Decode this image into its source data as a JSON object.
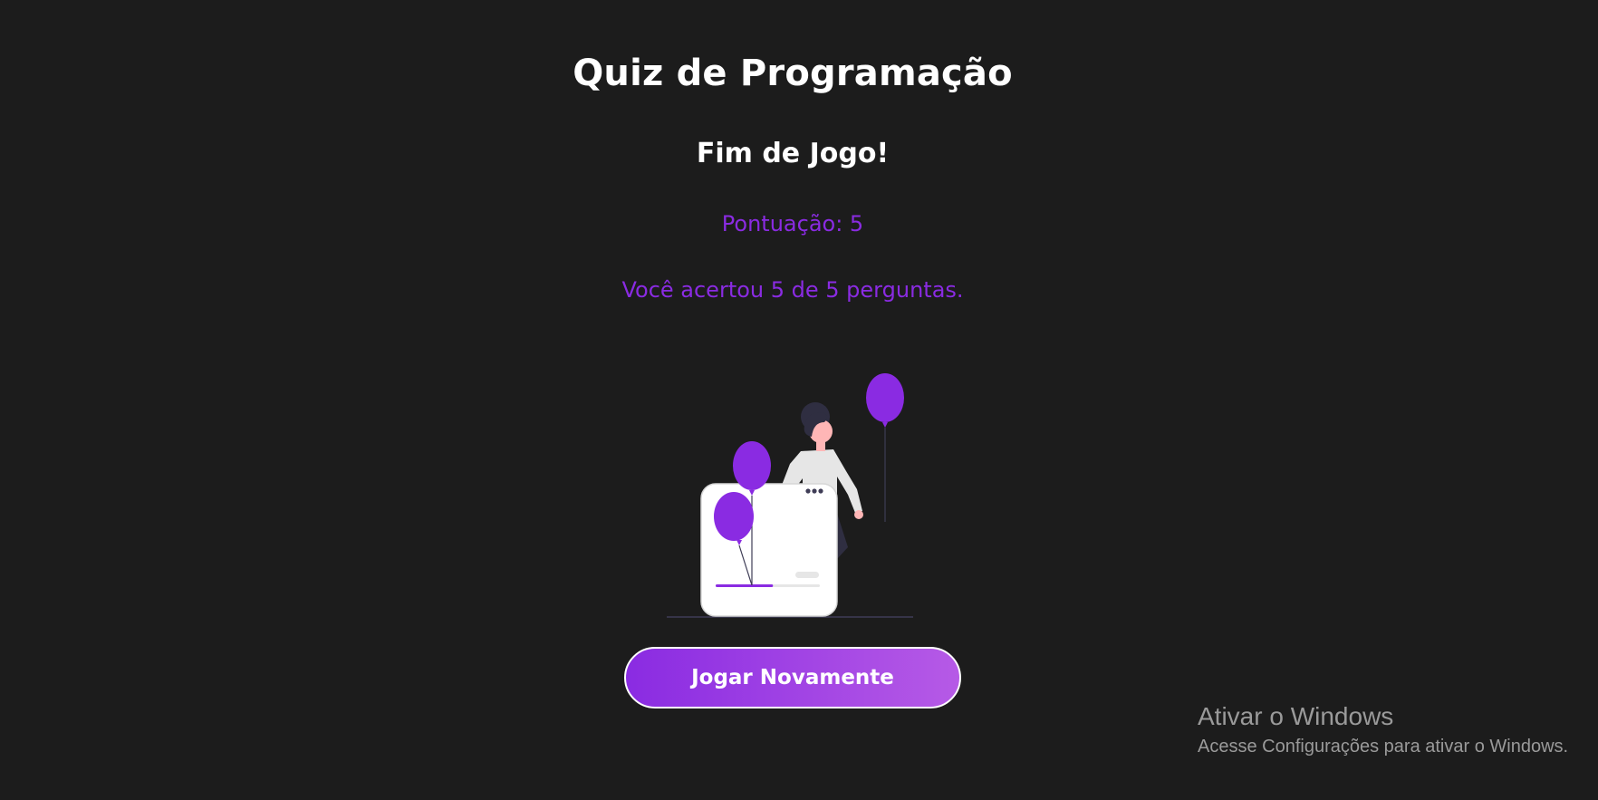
{
  "app": {
    "title": "Quiz de Programação"
  },
  "result": {
    "heading": "Fim de Jogo!",
    "score_text": "Pontuação: 5",
    "summary_text": "Você acertou 5 de 5 perguntas."
  },
  "actions": {
    "play_again_label": "Jogar Novamente"
  },
  "illustration": {
    "icon": "celebration-balloons-illustration",
    "progress": 0.55
  },
  "os_watermark": {
    "title": "Ativar o Windows",
    "subtitle": "Acesse Configurações para ativar o Windows."
  },
  "colors": {
    "background": "#1c1c1c",
    "accent": "#8a2be2",
    "accent_light": "#b65ae6",
    "text": "#ffffff"
  }
}
